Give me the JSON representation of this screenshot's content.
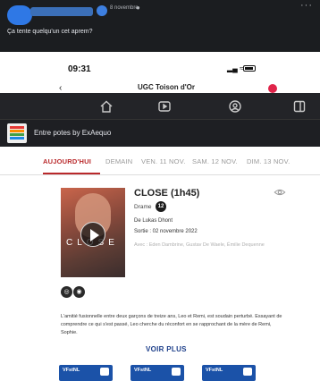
{
  "facebook_post": {
    "time": "8 novembre",
    "more": "···",
    "text": "Ça tente quelqu'un cet aprem?"
  },
  "phone": {
    "time": "09:31",
    "header_title": "UGC Toison d'Or",
    "back": "‹"
  },
  "shared_page": {
    "name": "Entre potes by ExAequo"
  },
  "tabs": [
    {
      "label": "AUJOURD'HUI"
    },
    {
      "label": "DEMAIN"
    },
    {
      "label": "VEN. 11 NOV."
    },
    {
      "label": "SAM. 12 NOV."
    },
    {
      "label": "DIM. 13 NOV."
    }
  ],
  "film": {
    "title": "CLOSE (1h45)",
    "poster_text": "CLOSE",
    "genre": "Drame",
    "age_rating": "12",
    "director": "De Lukas Dhont",
    "release": "Sortie : 02 novembre 2022",
    "cast": "Avec : Eden Dambrine, Gustav De Waele, Émilie Dequenne",
    "labels": [
      "◎",
      "◉"
    ],
    "synopsis": "L'amitié fusionnelle entre deux garçons de treize ans, Leo et Remi, est soudain perturbé. Essayant de comprendre ce qui s'est passé, Leo cherche du réconfort en se rapprochant de la mère de Remi, Sophie.",
    "more_label": "VOIR PLUS"
  },
  "sessions": [
    {
      "label": "VFstNL"
    },
    {
      "label": "VFstNL"
    },
    {
      "label": "VFstNL"
    }
  ],
  "colors": {
    "accent": "#b9292b",
    "link": "#1d3f8a",
    "session": "#1b52a8",
    "dark_bar": "#232428"
  }
}
